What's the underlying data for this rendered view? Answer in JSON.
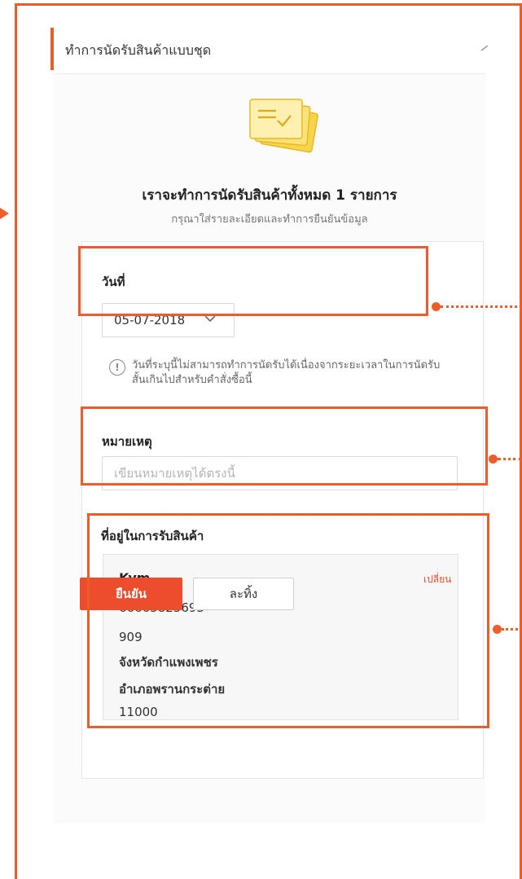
{
  "panel": {
    "title": "ทำการนัดรับสินค้าแบบชุด"
  },
  "summary": {
    "heading": "เราจะทำการนัดรับสินค้าทั้งหมด 1 รายการ",
    "subheading": "กรุณาใส่รายละเอียดและทำการยืนยันข้อมูล"
  },
  "date_field": {
    "label": "วันที่",
    "value": "05-07-2018",
    "notice": "วันที่ระบุนี้ไม่สามารถทำการนัดรับได้เนื่องจากระยะเวลาในการนัดรับสั้นเกินไปสำหรับคำสั่งซื้อนี้"
  },
  "note_field": {
    "label": "หมายเหตุ",
    "placeholder": "เขียนหมายเหตุได้ตรงนี้"
  },
  "address": {
    "label": "ที่อยู่ในการรับสินค้า",
    "name": "Kym",
    "change_label": "เปลี่ยน",
    "phone": "66665825693",
    "line1": "909",
    "province": "จังหวัดกำแพงเพชร",
    "district": "อำเภอพรานกระต่าย",
    "postcode": "11000"
  },
  "actions": {
    "confirm_label": "ยืนยัน",
    "cancel_label": "ละทิ้ง"
  },
  "colors": {
    "accent": "#ee4d2d",
    "annotation": "#ee5c2a",
    "illustration": "#f7d54a"
  },
  "icons": [
    "chevron-up-icon",
    "chevron-down-icon",
    "info-icon",
    "documents-illustration"
  ]
}
